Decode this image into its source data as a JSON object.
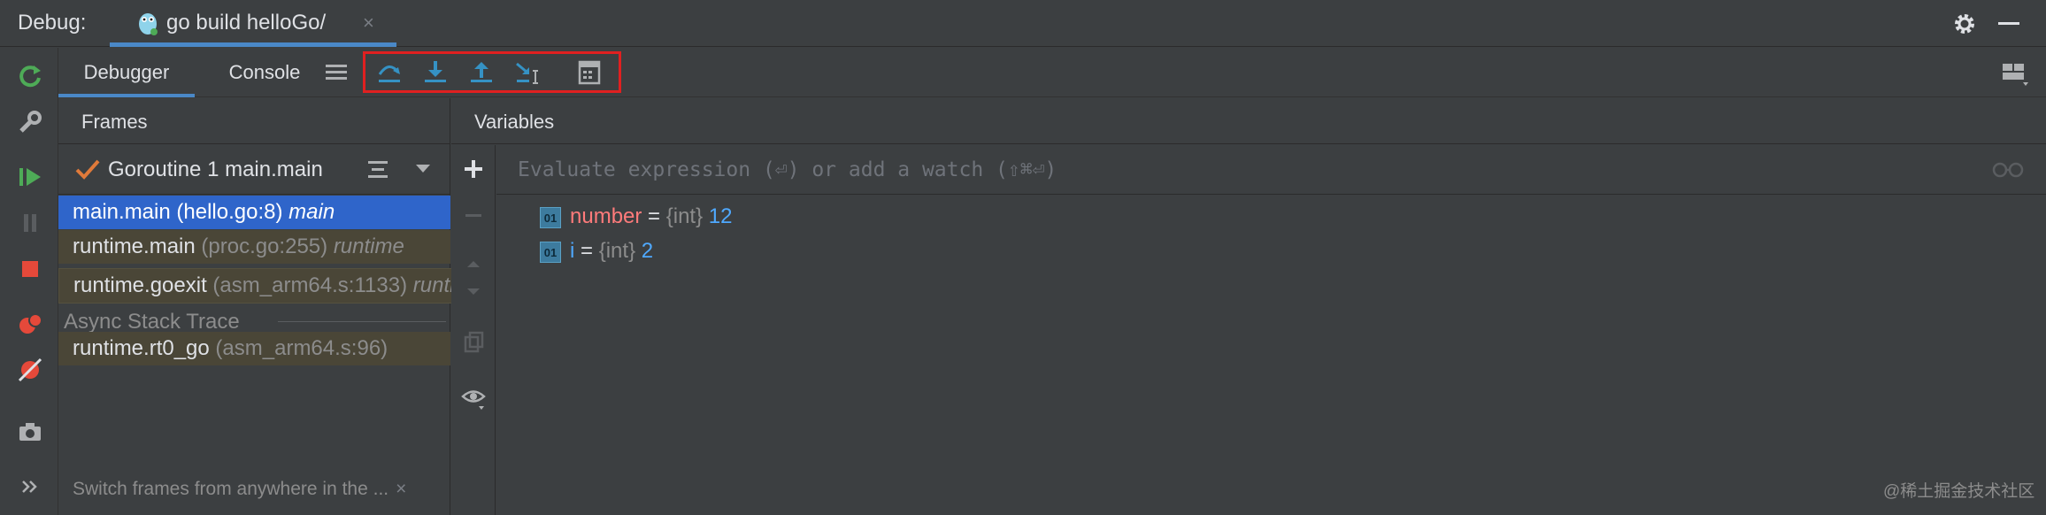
{
  "titlebar": {
    "label": "Debug:",
    "tab_title": "go build helloGo/",
    "close_glyph": "×"
  },
  "toolbar": {
    "tabs": [
      "Debugger",
      "Console"
    ]
  },
  "frames": {
    "header": "Frames",
    "goroutine": "Goroutine 1 main.main",
    "items": [
      {
        "func": "main.main",
        "loc": "(hello.go:8)",
        "pkg": "main"
      },
      {
        "func": "runtime.main",
        "loc": "(proc.go:255)",
        "pkg": "runtime"
      },
      {
        "func": "runtime.goexit",
        "loc": "(asm_arm64.s:1133)",
        "pkg": "runtime"
      }
    ],
    "async_label": "Async Stack Trace",
    "async_items": [
      {
        "func": "runtime.rt0_go",
        "loc": "(asm_arm64.s:96)"
      }
    ],
    "hint": "Switch frames from anywhere in the ...",
    "hint_close": "×"
  },
  "variables": {
    "header": "Variables",
    "eval_placeholder": "Evaluate expression (⏎) or add a watch (⇧⌘⏎)",
    "items": [
      {
        "icon": "01",
        "name": "number",
        "eq": " = ",
        "type": "{int}",
        "value": "12"
      },
      {
        "icon": "01",
        "name": "i",
        "eq": " = ",
        "type": "{int}",
        "value": "2"
      }
    ]
  },
  "watermark": "@稀土掘金技术社区",
  "colors": {
    "accent": "#4a88c7",
    "selection": "#2f65ca",
    "highlight_box": "#e02020",
    "resume_green": "#4eab57",
    "stop_red": "#e5493a"
  }
}
